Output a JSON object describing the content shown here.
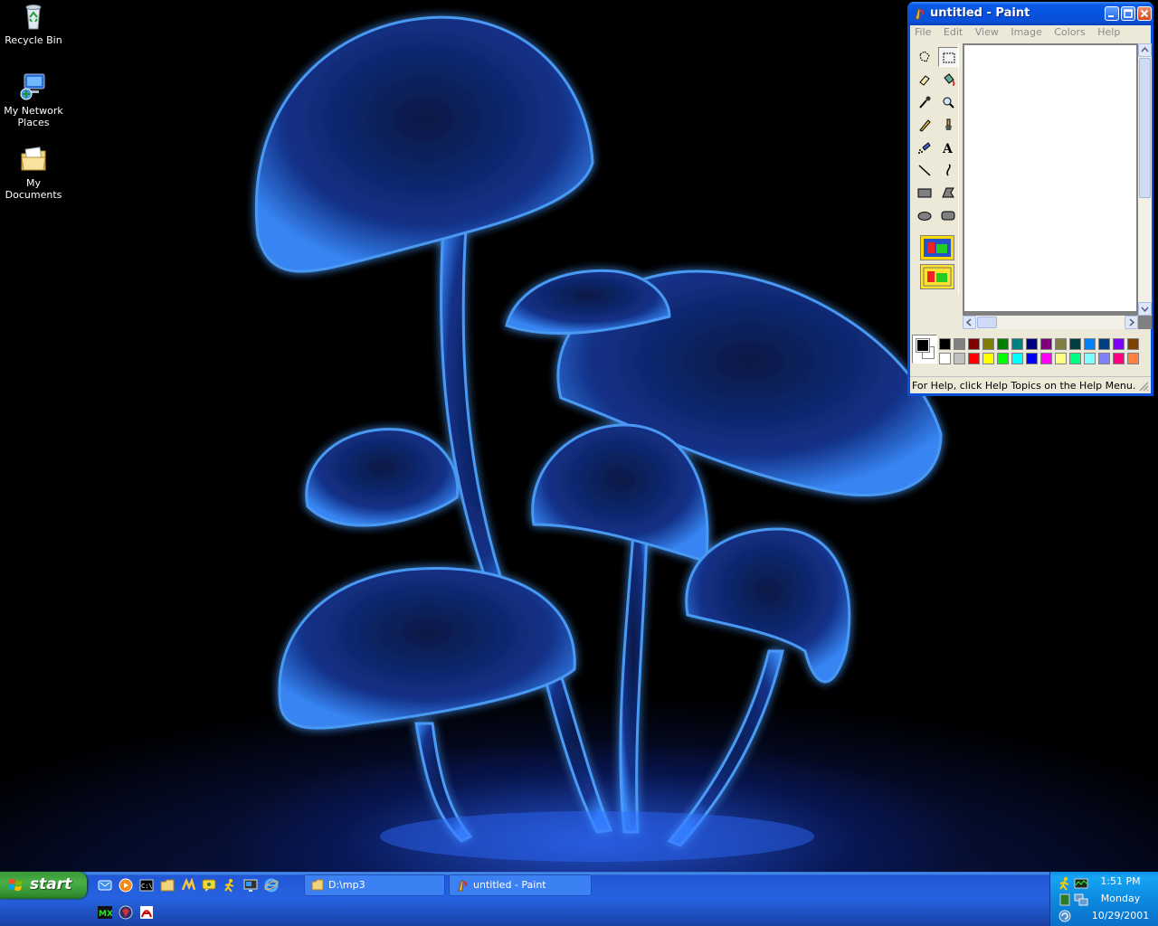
{
  "desktop": {
    "icons": [
      {
        "label": "Recycle Bin",
        "icon": "recycle-bin-icon"
      },
      {
        "label": "My Network Places",
        "icon": "network-places-icon"
      },
      {
        "label": "My Documents",
        "icon": "documents-folder-icon"
      }
    ]
  },
  "paint": {
    "title": "untitled - Paint",
    "menu": [
      "File",
      "Edit",
      "View",
      "Image",
      "Colors",
      "Help"
    ],
    "tools": [
      "free-form-select",
      "select",
      "eraser",
      "fill",
      "pick-color",
      "magnifier",
      "pencil",
      "brush",
      "airbrush",
      "text",
      "line",
      "curve",
      "rectangle",
      "polygon",
      "ellipse",
      "rounded-rectangle"
    ],
    "selected_tool": "select",
    "foreground_color": "#000000",
    "background_color": "#ffffff",
    "palette_top": [
      "#000000",
      "#808080",
      "#800000",
      "#808000",
      "#008000",
      "#008080",
      "#000080",
      "#800080",
      "#808040",
      "#004040",
      "#0080ff",
      "#004080",
      "#8000ff",
      "#804000"
    ],
    "palette_bottom": [
      "#ffffff",
      "#c0c0c0",
      "#ff0000",
      "#ffff00",
      "#00ff00",
      "#00ffff",
      "#0000ff",
      "#ff00ff",
      "#ffff80",
      "#00ff80",
      "#80ffff",
      "#8080ff",
      "#ff0080",
      "#ff8040"
    ],
    "status": "For Help, click Help Topics on the Help Menu."
  },
  "taskbar": {
    "start_label": "start",
    "quick_launch": [
      "outlook-express-icon",
      "media-player-icon",
      "command-prompt-icon",
      "explorer-folder-icon",
      "winamp-icon",
      "messenger-icon",
      "aim-icon",
      "remote-desktop-icon",
      "internet-explorer-icon",
      "mx-icon",
      "shield-icon",
      "acrobat-icon"
    ],
    "tasks": [
      {
        "label": "D:\\mp3",
        "icon": "folder-icon"
      },
      {
        "label": "untitled - Paint",
        "icon": "paint-icon"
      }
    ],
    "clock": {
      "time": "1:51 PM",
      "day": "Monday",
      "date": "10/29/2001"
    },
    "tray_icons": [
      "aim-running-man-icon",
      "network-monitor-icon",
      "volume-icon",
      "network-connections-icon",
      "windows-update-icon"
    ]
  },
  "colors": {
    "xp_blue": "#0a4fd7",
    "start_green": "#3d9e3b",
    "tray_blue": "#0c8ee8",
    "glow": "#3a8cff"
  }
}
